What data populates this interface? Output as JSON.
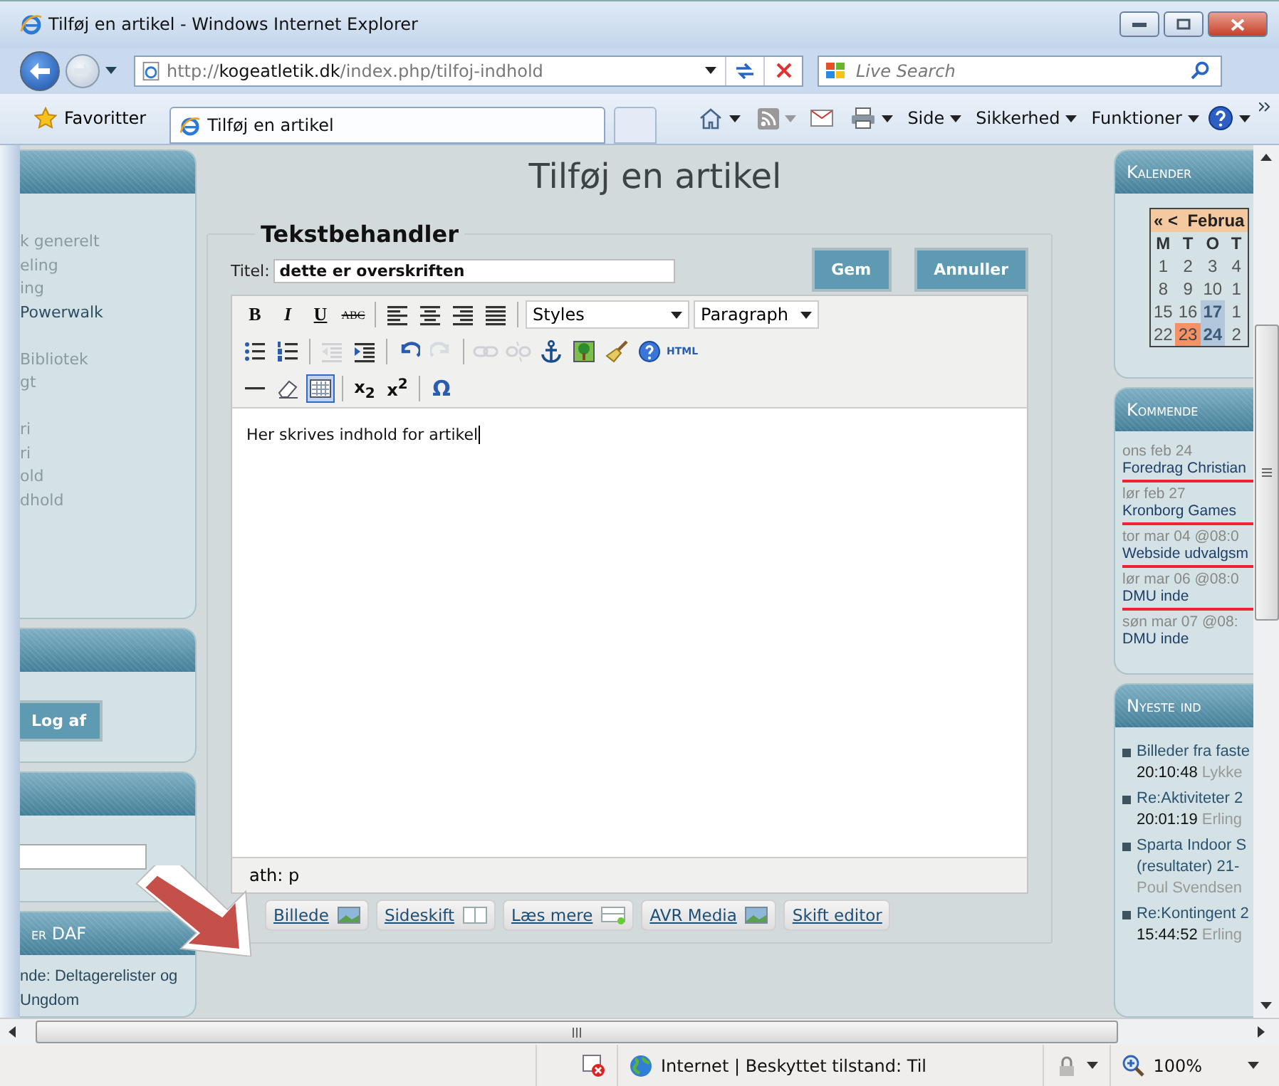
{
  "window": {
    "title": "Tilføj en artikel - Windows Internet Explorer"
  },
  "address_bar": {
    "scheme": "http://",
    "domain": "kogeatletik.dk",
    "path": "/index.php/tilfoj-indhold"
  },
  "search": {
    "placeholder": "Live Search"
  },
  "favorites": {
    "label": "Favoritter"
  },
  "tabs": [
    {
      "label": "Tilføj en artikel",
      "selected": true
    }
  ],
  "command_menus": [
    "Side",
    "Sikkerhed",
    "Funktioner"
  ],
  "left_sidebar": {
    "menu_groups": [
      [
        {
          "label": "k generelt",
          "current": false
        },
        {
          "label": "eling",
          "current": false
        },
        {
          "label": "ing",
          "current": false
        },
        {
          "label": "Powerwalk",
          "current": true
        }
      ],
      [
        {
          "label": "Bibliotek",
          "current": false
        },
        {
          "label": "gt",
          "current": false
        }
      ],
      [
        {
          "label": "ri",
          "current": false
        },
        {
          "label": "ri",
          "current": false
        },
        {
          "label": "old",
          "current": false
        },
        {
          "label": "dhold",
          "current": false
        }
      ]
    ],
    "logout_button": "Log af",
    "daf_module": {
      "title": "er DAF",
      "items": [
        "nde: Deltagerelister og",
        "Ungdom"
      ]
    }
  },
  "page": {
    "title": "Tilføj en artikel"
  },
  "editor": {
    "legend": "Tekstbehandler",
    "title_label": "Titel:",
    "title_value": "dette er overskriften",
    "buttons": [
      "Gem",
      "Annuller"
    ],
    "toolbar_rows": [
      [
        {
          "kind": "bold",
          "label": "B",
          "disabled": false,
          "pressed": false
        },
        {
          "kind": "italic",
          "label": "I",
          "disabled": false,
          "pressed": false
        },
        {
          "kind": "underline",
          "label": "U",
          "disabled": false,
          "pressed": false
        },
        {
          "kind": "strike",
          "label": "ABC",
          "disabled": false,
          "pressed": false
        },
        {
          "kind": "sep"
        },
        {
          "kind": "align-left",
          "disabled": false,
          "pressed": false
        },
        {
          "kind": "align-center",
          "disabled": false,
          "pressed": false
        },
        {
          "kind": "align-right",
          "disabled": false,
          "pressed": false
        },
        {
          "kind": "justify",
          "disabled": false,
          "pressed": false
        },
        {
          "kind": "sep"
        },
        {
          "kind": "select",
          "label": "Styles"
        },
        {
          "kind": "select",
          "label": "Paragraph"
        }
      ],
      [
        {
          "kind": "bullets",
          "disabled": false,
          "pressed": false
        },
        {
          "kind": "numbers",
          "disabled": false,
          "pressed": false
        },
        {
          "kind": "sep"
        },
        {
          "kind": "outdent",
          "disabled": true,
          "pressed": false
        },
        {
          "kind": "indent",
          "disabled": false,
          "pressed": false
        },
        {
          "kind": "sep"
        },
        {
          "kind": "undo",
          "disabled": false,
          "pressed": false
        },
        {
          "kind": "redo",
          "disabled": true,
          "pressed": false
        },
        {
          "kind": "sep"
        },
        {
          "kind": "link",
          "disabled": true,
          "pressed": false
        },
        {
          "kind": "unlink",
          "disabled": true,
          "pressed": false
        },
        {
          "kind": "anchor",
          "disabled": false,
          "pressed": false
        },
        {
          "kind": "image",
          "disabled": false,
          "pressed": false
        },
        {
          "kind": "cleanup",
          "disabled": false,
          "pressed": false
        },
        {
          "kind": "help",
          "disabled": false,
          "pressed": false
        },
        {
          "kind": "html",
          "label": "HTML",
          "disabled": false,
          "pressed": false
        }
      ],
      [
        {
          "kind": "hr",
          "disabled": false,
          "pressed": false
        },
        {
          "kind": "eraser",
          "disabled": false,
          "pressed": false
        },
        {
          "kind": "visualaid",
          "disabled": false,
          "pressed": true
        },
        {
          "kind": "sep"
        },
        {
          "kind": "subscript",
          "label": "x$_{2}$",
          "disabled": false,
          "pressed": false
        },
        {
          "kind": "superscript",
          "label": "x$^{2}$",
          "disabled": false,
          "pressed": false
        },
        {
          "kind": "sep"
        },
        {
          "kind": "symbol",
          "label": "Ω",
          "disabled": false,
          "pressed": false
        }
      ]
    ],
    "content": "Her skrives indhold for artikel",
    "path": "ath: p",
    "extra_buttons": [
      {
        "label": "Billede",
        "kind": "image"
      },
      {
        "label": "Sideskift",
        "kind": "pagebreak"
      },
      {
        "label": "Læs mere",
        "kind": "readmore"
      },
      {
        "label": "AVR Media",
        "kind": "image"
      },
      {
        "label": "Skift editor",
        "kind": "plain"
      }
    ]
  },
  "calendar": {
    "title": "Kalender",
    "nav": [
      "«",
      "<"
    ],
    "month": "Februa",
    "weekdays": [
      "M",
      "T",
      "O",
      "T"
    ],
    "weeks": [
      [
        {
          "day": "1",
          "today": false,
          "highlighted": false
        },
        {
          "day": "2",
          "today": false,
          "highlighted": false
        },
        {
          "day": "3",
          "today": false,
          "highlighted": false
        },
        {
          "day": "4",
          "today": false,
          "highlighted": false
        }
      ],
      [
        {
          "day": "8",
          "today": false,
          "highlighted": false
        },
        {
          "day": "9",
          "today": false,
          "highlighted": false
        },
        {
          "day": "10",
          "today": false,
          "highlighted": false
        },
        {
          "day": "1",
          "today": false,
          "highlighted": false
        }
      ],
      [
        {
          "day": "15",
          "today": false,
          "highlighted": false
        },
        {
          "day": "16",
          "today": false,
          "highlighted": false
        },
        {
          "day": "17",
          "today": false,
          "highlighted": true
        },
        {
          "day": "1",
          "today": false,
          "highlighted": false
        }
      ],
      [
        {
          "day": "22",
          "today": false,
          "highlighted": false
        },
        {
          "day": "23",
          "today": true,
          "highlighted": false
        },
        {
          "day": "24",
          "today": false,
          "highlighted": true
        },
        {
          "day": "2",
          "today": false,
          "highlighted": false
        }
      ]
    ]
  },
  "upcoming": {
    "title": "Kommende",
    "events": [
      {
        "date": "ons feb 24",
        "title": "Foredrag Christian"
      },
      {
        "date": "lør feb 27",
        "title": "Kronborg Games"
      },
      {
        "date": "tor mar 04 @08:0",
        "title": "Webside udvalgsm"
      },
      {
        "date": "lør mar 06 @08:0",
        "title": "DMU inde"
      },
      {
        "date": "søn mar 07 @08:",
        "title": "DMU inde"
      }
    ]
  },
  "newest": {
    "title": "Nyeste ind",
    "items": [
      {
        "title_lines": [
          "Billeder fra faste"
        ],
        "time": "20:10:48",
        "author": "Lykke"
      },
      {
        "title_lines": [
          "Re:Aktiviteter 2"
        ],
        "time": "20:01:19",
        "author": "Erling"
      },
      {
        "title_lines": [
          "Sparta Indoor S",
          "(resultater) 21-"
        ],
        "author": "Poul Svendsen"
      },
      {
        "title_lines": [
          "Re:Kontingent 2"
        ],
        "time": "15:44:52",
        "author": "Erling"
      }
    ]
  },
  "status_bar": {
    "zone": "Internet | Beskyttet tilstand: Til",
    "zoom": "100%"
  }
}
